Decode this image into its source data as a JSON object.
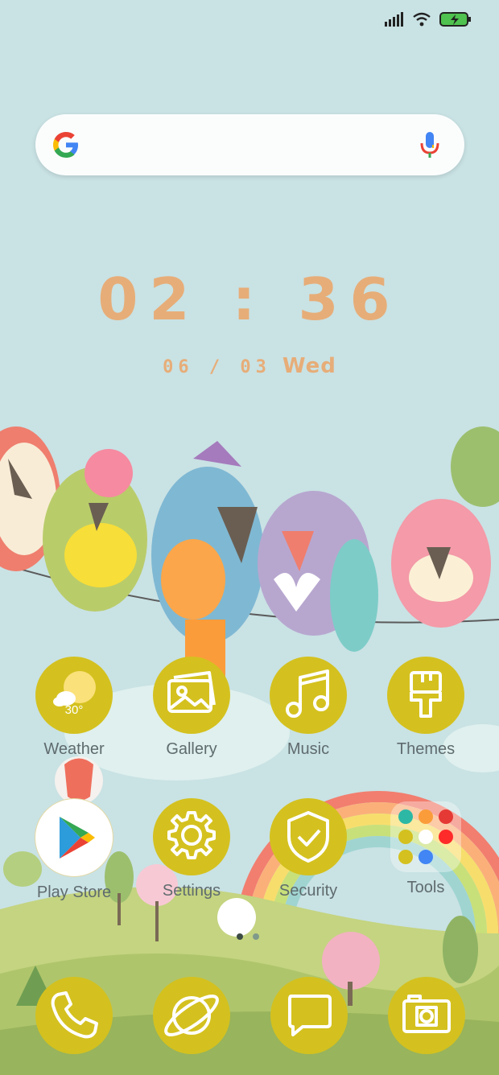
{
  "status_bar": {
    "signal_icon": "cellular-signal-icon",
    "wifi_icon": "wifi-icon",
    "battery_icon": "battery-charging-icon"
  },
  "search": {
    "logo_icon": "google-g-icon",
    "mic_icon": "microphone-icon"
  },
  "clock": {
    "time": "02 : 36",
    "date_numeric": "06 / 03",
    "weekday": "Wed"
  },
  "apps_row1": [
    {
      "label": "Weather",
      "icon": "weather-icon",
      "temp": "30°"
    },
    {
      "label": "Gallery",
      "icon": "gallery-icon"
    },
    {
      "label": "Music",
      "icon": "music-note-icon"
    },
    {
      "label": "Themes",
      "icon": "paintbrush-icon"
    }
  ],
  "apps_row2": [
    {
      "label": "Play Store",
      "icon": "play-store-icon"
    },
    {
      "label": "Settings",
      "icon": "gear-icon"
    },
    {
      "label": "Security",
      "icon": "shield-check-icon"
    },
    {
      "label": "Tools",
      "icon": "folder-icon"
    }
  ],
  "dock": [
    {
      "icon": "phone-icon"
    },
    {
      "icon": "browser-planet-icon"
    },
    {
      "icon": "message-icon"
    },
    {
      "icon": "camera-icon"
    }
  ],
  "pages": {
    "count": 2,
    "active": 1
  },
  "colors": {
    "accent": "#d4c11f",
    "clock": "#e7ad78",
    "background": "#c9e2e4",
    "label": "#5f6b6e"
  }
}
